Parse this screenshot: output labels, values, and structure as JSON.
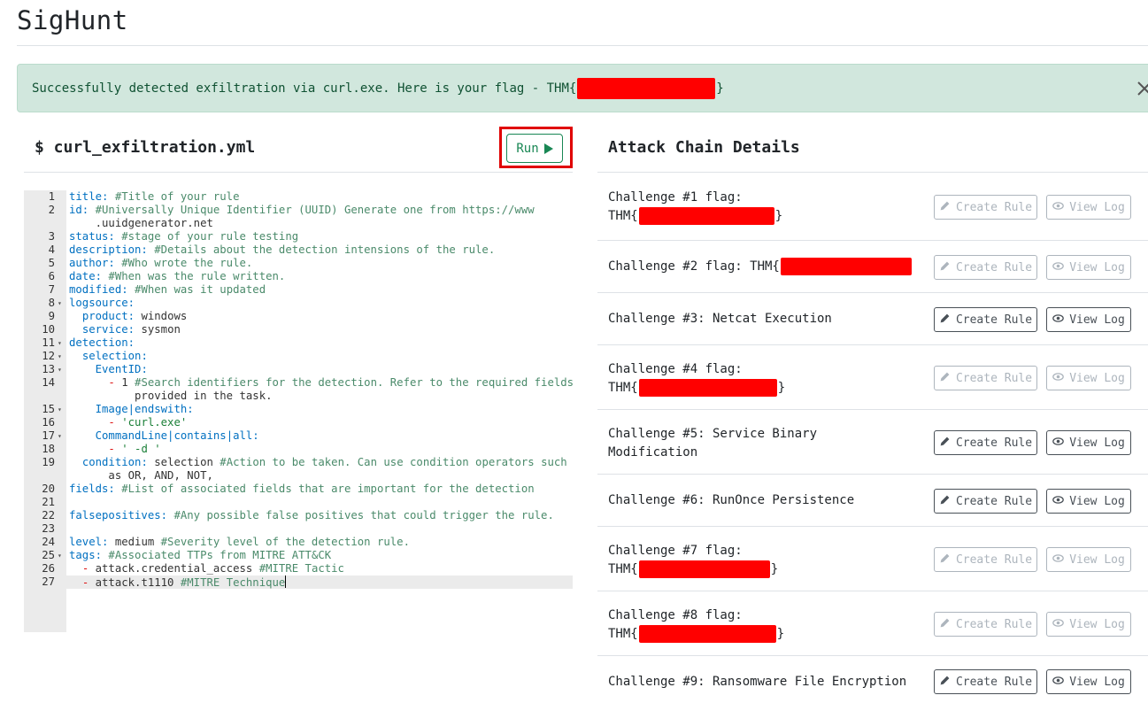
{
  "app": {
    "title": "SigHunt"
  },
  "alert": {
    "message": "Successfully detected exfiltration via curl.exe. Here is your flag - THM{",
    "suffix": "}",
    "color": "#d1e7dd",
    "close_icon": "close-icon"
  },
  "editor": {
    "filename": "$ curl_exfiltration.yml",
    "run_label": "Run",
    "lines": [
      {
        "n": "1",
        "text": "title: #Title of your rule"
      },
      {
        "n": "2",
        "text": "id: #Universally Unique Identifier (UUID) Generate one from https://www"
      },
      {
        "n": "",
        "text": "    .uuidgenerator.net"
      },
      {
        "n": "3",
        "text": "status: #stage of your rule testing"
      },
      {
        "n": "4",
        "text": "description: #Details about the detection intensions of the rule."
      },
      {
        "n": "5",
        "text": "author: #Who wrote the rule."
      },
      {
        "n": "6",
        "text": "date: #When was the rule written."
      },
      {
        "n": "7",
        "text": "modified: #When was it updated"
      },
      {
        "n": "8",
        "text": "logsource:"
      },
      {
        "n": "9",
        "text": "  product: windows"
      },
      {
        "n": "10",
        "text": "  service: sysmon"
      },
      {
        "n": "11",
        "text": "detection:"
      },
      {
        "n": "12",
        "text": "  selection:"
      },
      {
        "n": "13",
        "text": "    EventID:"
      },
      {
        "n": "14",
        "text": "      - 1 #Search identifiers for the detection. Refer to the required fields"
      },
      {
        "n": "",
        "text": "          provided in the task."
      },
      {
        "n": "15",
        "text": "    Image|endswith:"
      },
      {
        "n": "16",
        "text": "      - 'curl.exe'"
      },
      {
        "n": "17",
        "text": "    CommandLine|contains|all:"
      },
      {
        "n": "18",
        "text": "      - ' -d '"
      },
      {
        "n": "19",
        "text": "  condition: selection #Action to be taken. Can use condition operators such"
      },
      {
        "n": "",
        "text": "      as OR, AND, NOT,"
      },
      {
        "n": "20",
        "text": "fields: #List of associated fields that are important for the detection"
      },
      {
        "n": "21",
        "text": ""
      },
      {
        "n": "22",
        "text": "falsepositives: #Any possible false positives that could trigger the rule."
      },
      {
        "n": "23",
        "text": ""
      },
      {
        "n": "24",
        "text": "level: medium #Severity level of the detection rule."
      },
      {
        "n": "25",
        "text": "tags: #Associated TTPs from MITRE ATT&CK"
      },
      {
        "n": "26",
        "text": "  - attack.credential_access #MITRE Tactic"
      },
      {
        "n": "27",
        "text": "  - attack.t1110 #MITRE Technique"
      }
    ]
  },
  "panel": {
    "title": "Attack Chain Details",
    "create_label": "Create Rule",
    "view_label": "View Log",
    "challenges": [
      {
        "line1": "Challenge #1 flag:",
        "line2_prefix": "THM{",
        "line2_suffix": "}",
        "redacted": true,
        "enabled": false
      },
      {
        "line1": "Challenge #2 flag: THM{",
        "line2_prefix": "",
        "line2_suffix": "",
        "redacted": true,
        "enabled": false
      },
      {
        "line1": "Challenge #3: Netcat Execution",
        "line2_prefix": "",
        "line2_suffix": "",
        "redacted": false,
        "enabled": true
      },
      {
        "line1": "Challenge #4 flag:",
        "line2_prefix": "THM{",
        "line2_suffix": "}",
        "redacted": true,
        "enabled": false
      },
      {
        "line1": "Challenge #5: Service Binary",
        "line2_prefix": "Modification",
        "line2_suffix": "",
        "redacted": false,
        "enabled": true
      },
      {
        "line1": "Challenge #6: RunOnce Persistence",
        "line2_prefix": "",
        "line2_suffix": "",
        "redacted": false,
        "enabled": true
      },
      {
        "line1": "Challenge #7 flag:",
        "line2_prefix": "THM{",
        "line2_suffix": "}",
        "redacted": true,
        "enabled": false
      },
      {
        "line1": "Challenge #8 flag:",
        "line2_prefix": "THM{",
        "line2_suffix": "}",
        "redacted": true,
        "enabled": false
      },
      {
        "line1": "Challenge #9: Ransomware File Encryption",
        "line2_prefix": "",
        "line2_suffix": "",
        "redacted": false,
        "enabled": true
      }
    ]
  }
}
